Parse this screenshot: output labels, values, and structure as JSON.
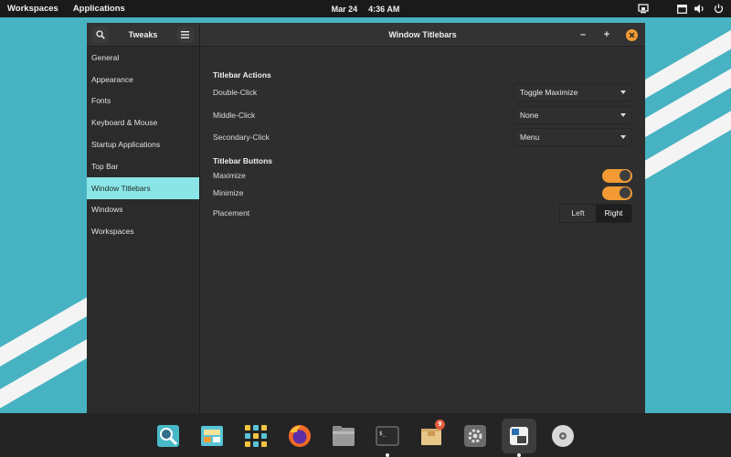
{
  "topbar": {
    "workspaces": "Workspaces",
    "applications": "Applications",
    "date": "Mar 24",
    "time": "4:36 AM",
    "icons": [
      "screen-share-icon",
      "display-icon",
      "volume-icon",
      "power-icon"
    ]
  },
  "sidebar": {
    "title": "Tweaks",
    "items": [
      {
        "label": "General"
      },
      {
        "label": "Appearance"
      },
      {
        "label": "Fonts"
      },
      {
        "label": "Keyboard & Mouse"
      },
      {
        "label": "Startup Applications"
      },
      {
        "label": "Top Bar"
      },
      {
        "label": "Window Titlebars"
      },
      {
        "label": "Windows"
      },
      {
        "label": "Workspaces"
      }
    ],
    "active_index": 6
  },
  "main": {
    "title": "Window Titlebars",
    "sections": {
      "actions_heading": "Titlebar Actions",
      "buttons_heading": "Titlebar Buttons"
    },
    "actions": [
      {
        "label": "Double-Click",
        "value": "Toggle Maximize"
      },
      {
        "label": "Middle-Click",
        "value": "None"
      },
      {
        "label": "Secondary-Click",
        "value": "Menu"
      }
    ],
    "buttons": [
      {
        "label": "Maximize",
        "enabled": true
      },
      {
        "label": "Minimize",
        "enabled": true
      }
    ],
    "placement": {
      "label": "Placement",
      "left": "Left",
      "right": "Right",
      "selected": "Right"
    }
  },
  "dock": {
    "badge_count": "9",
    "apps": [
      "magnifier-icon",
      "store-icon",
      "app-grid-icon",
      "firefox-icon",
      "files-icon",
      "terminal-icon",
      "package-icon",
      "settings-icon",
      "tweaks-icon",
      "disc-icon"
    ]
  },
  "colors": {
    "accent": "#8be5e6",
    "switch_on": "#f39a34",
    "close": "#f39a34",
    "wallpaper": "#47b2c2"
  }
}
